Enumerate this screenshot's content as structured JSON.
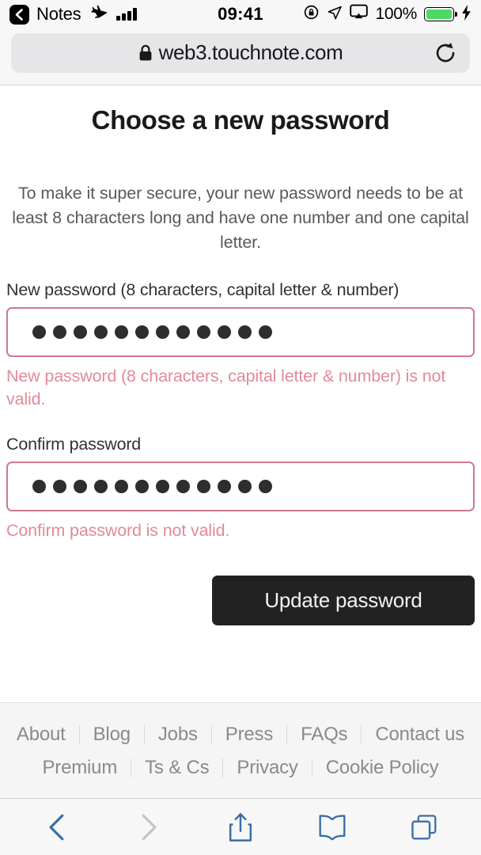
{
  "status_bar": {
    "back_app_label": "Notes",
    "back_chevron_icon": "chevron-left-icon",
    "airplane_icon": "airplane-mode-icon",
    "signal_icon": "cellular-signal-icon",
    "time": "09:41",
    "rotation_lock_icon": "rotation-lock-icon",
    "location_icon": "location-arrow-icon",
    "airplay_icon": "airplay-screen-mirror-icon",
    "battery_percent": "100%",
    "battery_icon": "battery-full-icon",
    "charging_icon": "lightning-bolt-icon",
    "battery_color": "#4cd964"
  },
  "browser": {
    "lock_icon": "lock-icon",
    "url": "web3.touchnote.com",
    "reload_icon": "reload-icon"
  },
  "page": {
    "title": "Choose a new password",
    "intro": "To make it super secure, your new password needs to be at least 8 characters long and have one number and one capital letter.",
    "new_password": {
      "label": "New password (8 characters, capital letter & number)",
      "value_masked_length": 12,
      "error": "New password (8 characters, capital letter & number) is not valid.",
      "placeholder": ""
    },
    "confirm_password": {
      "label": "Confirm password",
      "value_masked_length": 12,
      "error": "Confirm password is not valid.",
      "placeholder": ""
    },
    "submit_label": "Update password",
    "error_color": "#e38a98",
    "input_border_color": "#d0798c",
    "button_color": "#222222"
  },
  "footer": {
    "row1": [
      "About",
      "Blog",
      "Jobs",
      "Press",
      "FAQs",
      "Contact us"
    ],
    "row2": [
      "Premium",
      "Ts & Cs",
      "Privacy",
      "Cookie Policy"
    ]
  },
  "toolbar": {
    "back_icon": "chevron-left-icon",
    "forward_icon": "chevron-right-icon",
    "share_icon": "share-icon",
    "bookmarks_icon": "book-icon",
    "tabs_icon": "tabs-icon",
    "active_color": "#3a6ea5",
    "disabled_color": "#c4c4c6"
  }
}
